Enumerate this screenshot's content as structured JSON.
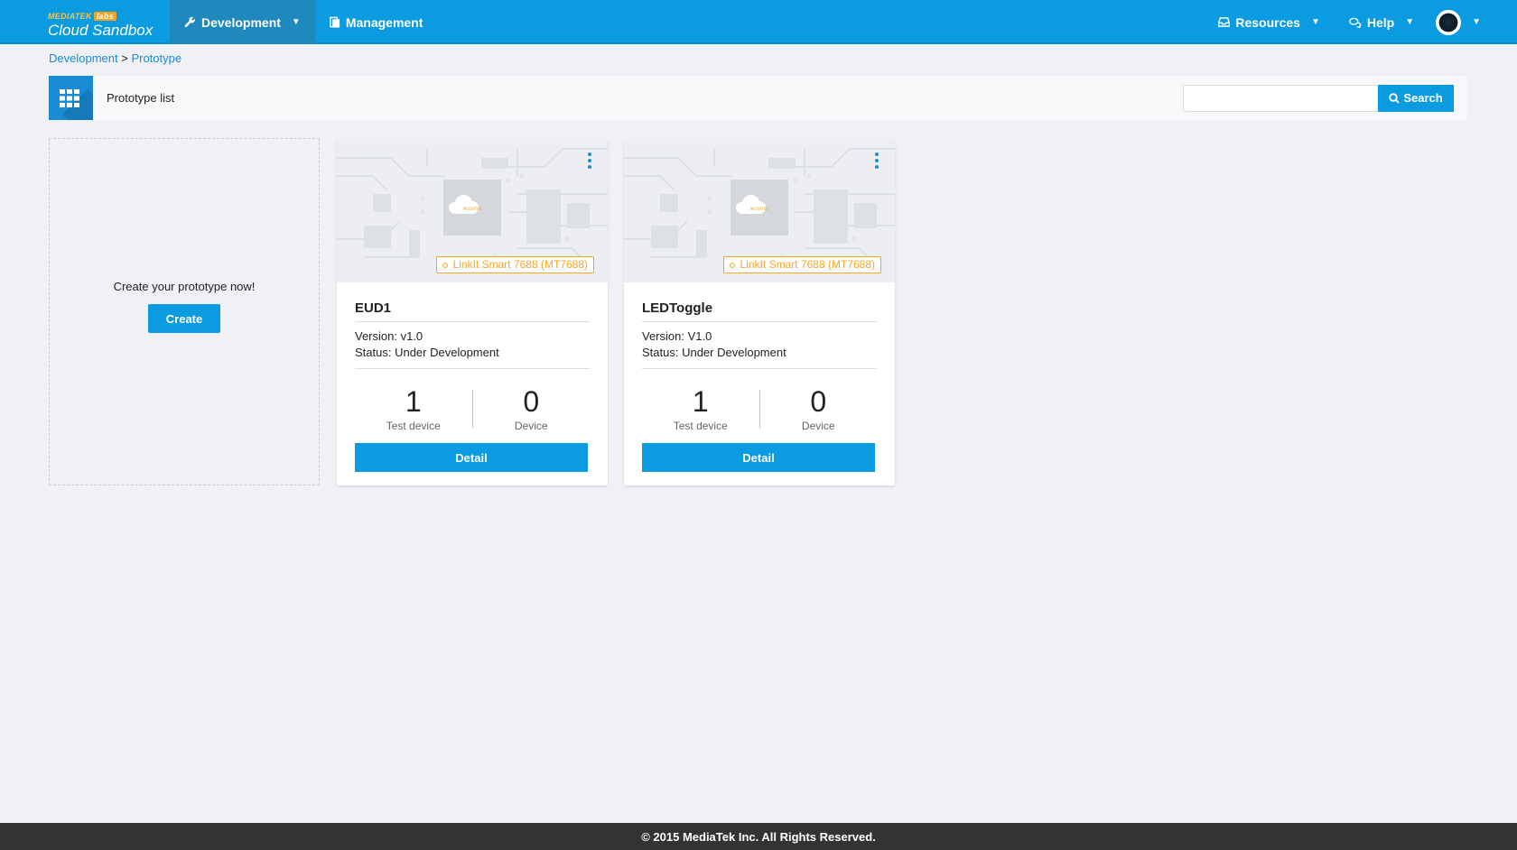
{
  "brand": {
    "top": "MEDIATEK",
    "labs": "labs",
    "main": "Cloud Sandbox"
  },
  "nav": {
    "development": "Development",
    "management": "Management",
    "resources": "Resources",
    "help": "Help"
  },
  "breadcrumb": {
    "root": "Development",
    "separator": ">",
    "current": "Prototype"
  },
  "listbar": {
    "title": "Prototype list",
    "search_placeholder": "",
    "search_label": "Search"
  },
  "create": {
    "message": "Create your prototype now!",
    "button": "Create"
  },
  "prototypes": [
    {
      "board": "LinkIt Smart 7688 (MT7688)",
      "name": "EUD1",
      "version": "Version: v1.0",
      "status": "Status: Under Development",
      "test_device_count": "1",
      "test_device_label": "Test device",
      "device_count": "0",
      "device_label": "Device",
      "detail_label": "Detail"
    },
    {
      "board": "LinkIt Smart 7688 (MT7688)",
      "name": "LEDToggle",
      "version": "Version: V1.0",
      "status": "Status: Under Development",
      "test_device_count": "1",
      "test_device_label": "Test device",
      "device_count": "0",
      "device_label": "Device",
      "detail_label": "Detail"
    }
  ],
  "footer": {
    "copyright": "© 2015 MediaTek Inc. All Rights Reserved."
  },
  "colors": {
    "primary": "#0a9be0",
    "nav_active": "#1f88bd",
    "link": "#1a8bd4",
    "tag": "#f5a623",
    "footer": "#333331",
    "page_bg": "#f0f1f5"
  }
}
